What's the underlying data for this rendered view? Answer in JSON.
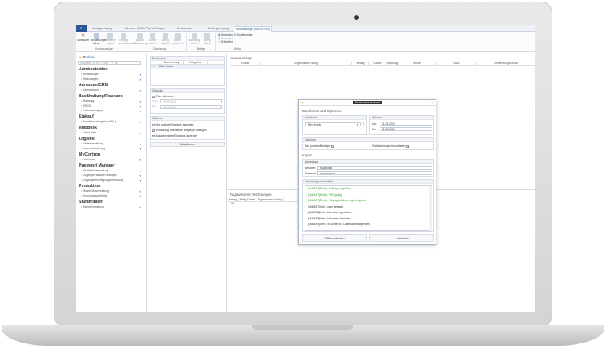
{
  "tabs": {
    "file": "≡",
    "items": [
      "Zahlungseingang",
      "Adressen (10100 PayPal Europe)",
      "Einstellungen",
      "Zahlungseingang",
      "Kontoauszüge (HBCI/FinTS)"
    ]
  },
  "ribbon": {
    "buttons": [
      "Schließen",
      "Einstellungen öffnen",
      "Manueller Import",
      "Eintrag ein-/ausblenden",
      "Autom. Zuweisung",
      "Kunde suchen",
      "Beleg suchen",
      "Beleg entfernen",
      "Buchung starten",
      "Beleg öffnen"
    ],
    "groups": [
      "Kontoauszüge",
      "Zuweisung",
      "Belege",
      "Modul"
    ],
    "modul": {
      "undock": "Abdocken",
      "dock": "Andocken",
      "close": "Schließen",
      "settings": "Einstellungen"
    }
  },
  "sidebar": {
    "title": "Module",
    "search_placeholder": "Suchtext (STRG + SHIFT + F6)",
    "sections": [
      {
        "title": "Administration",
        "items": [
          "Einstellungen",
          "Mailvorlagen"
        ]
      },
      {
        "title": "Adressen/CRM",
        "items": [
          "Adressstamm"
        ]
      },
      {
        "title": "Buchhaltung/Finanzen",
        "items": [
          "Mahnung",
          "DROS",
          "Zahlungseingang"
        ]
      },
      {
        "title": "Einkauf",
        "items": [
          "Bestellvorschlagsliste (BVL)"
        ]
      },
      {
        "title": "Helpdesk",
        "items": [
          "Ticket-Liste"
        ]
      },
      {
        "title": "Logistik",
        "items": [
          "Artikelverwaltung",
          "Kommissionierung"
        ]
      },
      {
        "title": "MyCentron",
        "items": [
          "Telefonate"
        ]
      },
      {
        "title": "Passwort Manager",
        "items": [
          "Richtlinienverwaltung",
          "Zugänge/Passwort Manager",
          "Zugangsberechtigungsverwaltung"
        ]
      },
      {
        "title": "Produktion",
        "items": [
          "Maschinenverwaltung",
          "Produktionsaufträge"
        ]
      },
      {
        "title": "Stammdaten",
        "items": [
          "Reportverwaltung"
        ]
      }
    ]
  },
  "filter": {
    "bankkonten": {
      "title": "Bankkonten",
      "cols": [
        "Bezeichnung",
        "Zweigstelle"
      ],
      "row": "Mein Konto"
    },
    "zeitraum": {
      "title": "Zeitraum",
      "filter_label": "Filter aktivieren",
      "von_label": "Von:",
      "von": "20.03.2024",
      "bis_label": "Bis:",
      "bis": "11.06.2024"
    },
    "optionen": {
      "title": "Optionen",
      "items": [
        "Nur positive Eingänge anzeigen",
        "Vollständig bearbeitete Eingänge anzeigen",
        "Ausgeblendete Eingänge anzeigen"
      ]
    },
    "refresh": "Aktualisieren"
  },
  "statements": {
    "title": "Kontoauszüge",
    "cols": [
      "Kunde",
      "Zugeordneter Beleg",
      "Betrag",
      "Datum",
      "Währung",
      "Sender",
      "IBAN",
      "Verwendungszweck"
    ]
  },
  "invoices": {
    "title": "Zugewiesene Rechnungen",
    "cols": [
      "Betrag Ät.",
      "Beleg Datum",
      "Zugeordneter Betrag"
    ]
  },
  "dialog": {
    "title": "Kontoumsätze laden",
    "heading": "Bankkonto und Optionen",
    "bankkonto_label": "Bankkonto",
    "bankkonto": "Mein Konto",
    "zeitraum_label": "Zeitraum",
    "von_label": "Von:",
    "von": "11.03.2024",
    "bis_label": "Bis:",
    "bis": "11.06.2024",
    "optionen_label": "Optionen",
    "positive_label": "Nur positive Beträge:",
    "rueck_label": "Rückbuchungen importieren:",
    "import_heading": "Import",
    "anmeldung_label": "Anmeldung",
    "user_label": "Benutzer:",
    "user": "mustschak",
    "pw_label": "Passwort:",
    "pw": "••••••••••••••••",
    "log_label": "Verbindungsnachrichten",
    "log": [
      {
        "t": "[16:48:37] Erfolg: Auftrag ausgeführt",
        "ok": true
      },
      {
        "t": "[16:48:37] Erfolg: *PIN gültig",
        "ok": true
      },
      {
        "t": "[16:48:37] Erfolg: *Dialoginitialisierung erfolgreich",
        "ok": true
      },
      {
        "t": "[16:48:37] Info: Login beendet",
        "ok": false
      },
      {
        "t": "[16:48:38] Info: Datenabruf gestartet...",
        "ok": false
      },
      {
        "t": "[16:48:38] Info: Datenabruf beendet",
        "ok": false
      },
      {
        "t": "[16:48:39] Info: Es wurden 81 Datensätze abgerufen",
        "ok": false
      }
    ],
    "fetch": "Daten abrufen",
    "close": "Schließen"
  },
  "colors": {
    "accent": "#2b5797",
    "success": "#3a9a3a",
    "close_red": "#d9452b"
  }
}
